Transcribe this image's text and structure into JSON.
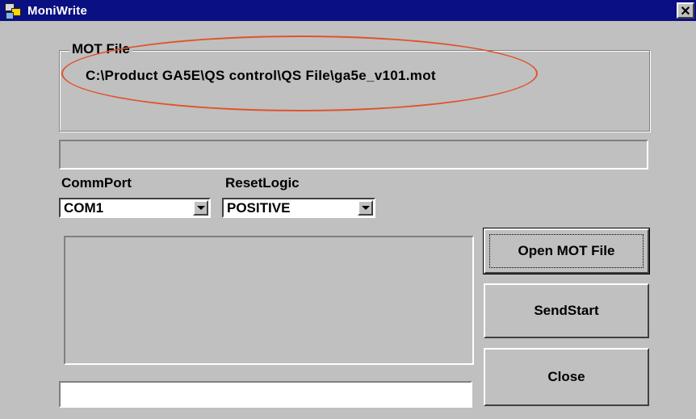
{
  "window": {
    "title": "MoniWrite",
    "close_glyph": "✕"
  },
  "mot_file": {
    "group_label": "MOT File",
    "path": "C:\\Product GA5E\\QS control\\QS File\\ga5e_v101.mot"
  },
  "comm_port": {
    "label": "CommPort",
    "selected": "COM1"
  },
  "reset_logic": {
    "label": "ResetLogic",
    "selected": "POSITIVE"
  },
  "buttons": {
    "open_mot": "Open MOT File",
    "send_start": "SendStart",
    "close": "Close"
  },
  "status": {
    "value": ""
  },
  "colors": {
    "titlebar": "#0a1082",
    "face": "#c0c0c0",
    "annotation_ellipse": "#e0532c"
  },
  "icons": {
    "app": "moniwrite-app-icon",
    "close": "close-icon",
    "dropdown": "chevron-down-icon"
  }
}
